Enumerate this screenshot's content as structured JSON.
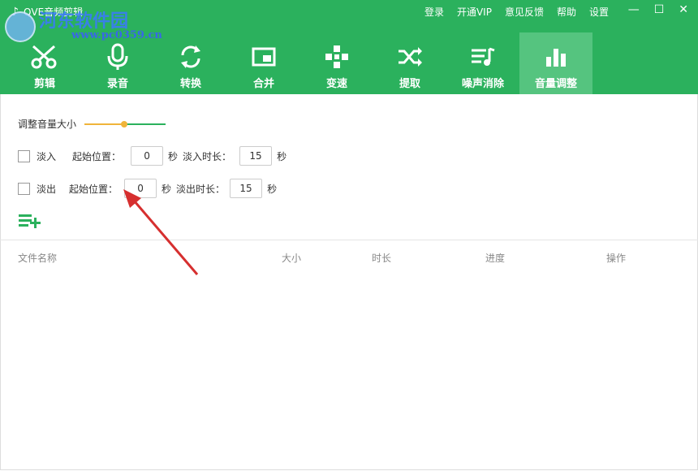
{
  "app": {
    "title": "QVE音频剪辑"
  },
  "watermark": {
    "text": "河东软件园",
    "url": "www.pc0359.cn"
  },
  "topmenu": [
    "登录",
    "开通VIP",
    "意见反馈",
    "帮助",
    "设置"
  ],
  "window_controls": {
    "minimize": "—",
    "maximize": "☐",
    "close": "✕"
  },
  "tabs": [
    {
      "label": "剪辑",
      "icon": "scissors-icon"
    },
    {
      "label": "录音",
      "icon": "microphone-icon"
    },
    {
      "label": "转换",
      "icon": "convert-icon"
    },
    {
      "label": "合并",
      "icon": "merge-icon"
    },
    {
      "label": "变速",
      "icon": "speed-icon"
    },
    {
      "label": "提取",
      "icon": "extract-icon"
    },
    {
      "label": "噪声消除",
      "icon": "noise-icon"
    },
    {
      "label": "音量调整",
      "icon": "volume-icon",
      "active": true
    }
  ],
  "volume": {
    "label": "调整音量大小",
    "level": 0.5
  },
  "fade_in": {
    "checkbox_label": "淡入",
    "start_label": "起始位置：",
    "start_value": "0",
    "unit": "秒",
    "duration_label": "淡入时长：",
    "duration_value": "15",
    "unit2": "秒"
  },
  "fade_out": {
    "checkbox_label": "淡出",
    "start_label": "起始位置：",
    "start_value": "0",
    "unit": "秒",
    "duration_label": "淡出时长：",
    "duration_value": "15",
    "unit2": "秒"
  },
  "table": {
    "columns": [
      "文件名称",
      "大小",
      "时长",
      "进度",
      "操作"
    ]
  },
  "colors": {
    "brand": "#2bb15d",
    "active_tab": "#55c47f",
    "slider": "#f0b43a",
    "arrow": "#d62f2f"
  }
}
